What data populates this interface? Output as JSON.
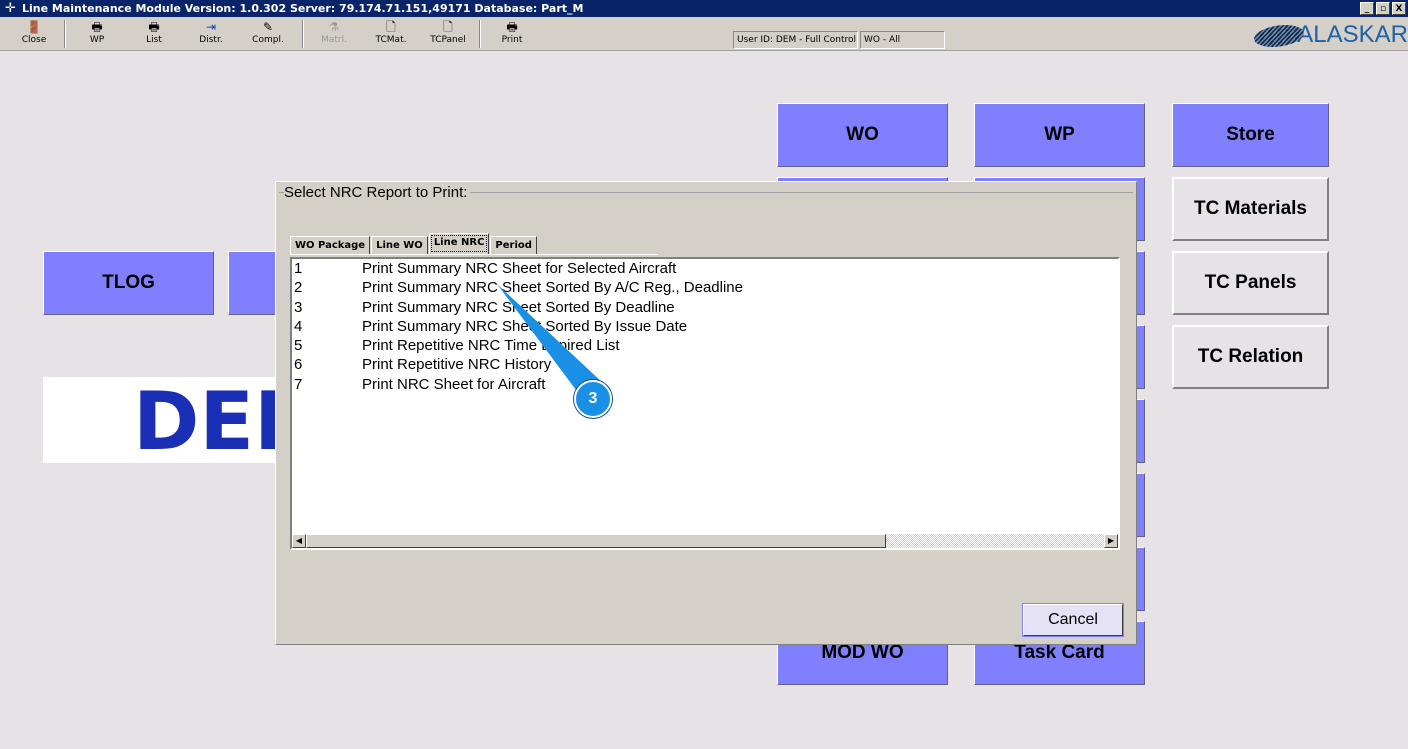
{
  "window": {
    "title": "Line Maintenance Module  Version: 1.0.302 Server: 79.174.71.151,49171 Database: Part_M",
    "controls": [
      "_",
      "▫",
      "X"
    ]
  },
  "toolbar": {
    "buttons": [
      {
        "label": "Close",
        "icon": "door-exit-icon",
        "enabled": true
      },
      {
        "label": "WP",
        "icon": "printer-icon",
        "enabled": true
      },
      {
        "label": "List",
        "icon": "printer-icon",
        "enabled": true
      },
      {
        "label": "Distr.",
        "icon": "distribute-icon",
        "enabled": true
      },
      {
        "label": "Compl.",
        "icon": "complete-icon",
        "enabled": true
      },
      {
        "label": "Matrl.",
        "icon": "material-icon",
        "enabled": false
      },
      {
        "label": "TCMat.",
        "icon": "document-icon",
        "enabled": true
      },
      {
        "label": "TCPanel",
        "icon": "document-icon",
        "enabled": true
      },
      {
        "label": "Print",
        "icon": "printer-icon",
        "enabled": true
      }
    ],
    "user_status": "User ID: DEM - Full Control",
    "wo_status": "WO - All",
    "logo": "ALASKAR"
  },
  "main": {
    "buttons": {
      "wo": "WO",
      "wp": "WP",
      "store": "Store",
      "tc_materials": "TC Materials",
      "tc_panels": "TC Panels",
      "tc_relation": "TC Relation",
      "tlog": "TLOG",
      "mod_wo": "MOD WO",
      "task_card": "Task Card"
    },
    "demo_banner": "DEMO"
  },
  "dialog": {
    "title": "Select NRC Report to Print:",
    "tabs": [
      "WO Package",
      "Line WO",
      "Line NRC",
      "Period"
    ],
    "active_tab": "Line NRC",
    "items": [
      {
        "n": "1",
        "label": "Print Summary NRC Sheet for Selected Aircraft"
      },
      {
        "n": "2",
        "label": "Print Summary NRC Sheet Sorted By A/C Reg., Deadline"
      },
      {
        "n": "3",
        "label": "Print Summary NRC Sheet Sorted By Deadline"
      },
      {
        "n": "4",
        "label": "Print Summary NRC Sheet Sorted By Issue Date"
      },
      {
        "n": "5",
        "label": "Print Repetitive NRC Time Expired List"
      },
      {
        "n": "6",
        "label": "Print Repetitive NRC History"
      },
      {
        "n": "7",
        "label": "Print NRC Sheet for Aircraft"
      }
    ],
    "cancel": "Cancel"
  },
  "annotation": {
    "step": "3"
  }
}
